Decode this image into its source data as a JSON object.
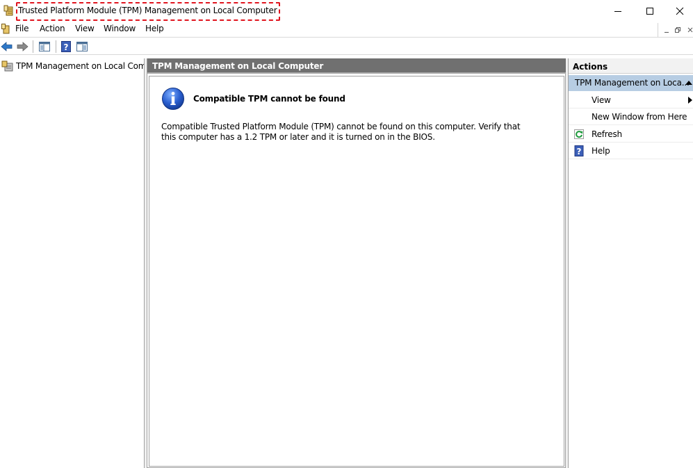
{
  "window": {
    "title": "Trusted Platform Module (TPM) Management on Local Computer"
  },
  "menu": {
    "items": [
      "File",
      "Action",
      "Window",
      "Help"
    ],
    "file": "File",
    "action": "Action",
    "view": "View",
    "window": "Window",
    "help": "Help"
  },
  "toolbar": {
    "icons": [
      "back-arrow-icon",
      "forward-arrow-icon",
      "show-hide-console-tree-icon",
      "help-icon",
      "show-hide-action-pane-icon"
    ]
  },
  "tree": {
    "root_label": "TPM Management on Local Comp"
  },
  "center": {
    "header": "TPM Management on Local Computer",
    "message_title": "Compatible TPM cannot be found",
    "message_body": "Compatible Trusted Platform Module (TPM) cannot be found on this computer. Verify that this computer has a 1.2 TPM or later and it is turned on in the BIOS."
  },
  "actions": {
    "header": "Actions",
    "group_label": "TPM Management on Loca...",
    "items": [
      {
        "label": "View",
        "icon": "",
        "has_submenu": true
      },
      {
        "label": "New Window from Here",
        "icon": "",
        "has_submenu": false
      },
      {
        "label": "Refresh",
        "icon": "refresh-icon",
        "has_submenu": false
      },
      {
        "label": "Help",
        "icon": "help-icon",
        "has_submenu": false
      }
    ]
  },
  "colors": {
    "highlight_border": "#e0141e",
    "center_header_bg": "#707070",
    "actions_group_bg": "#b7cde3"
  }
}
